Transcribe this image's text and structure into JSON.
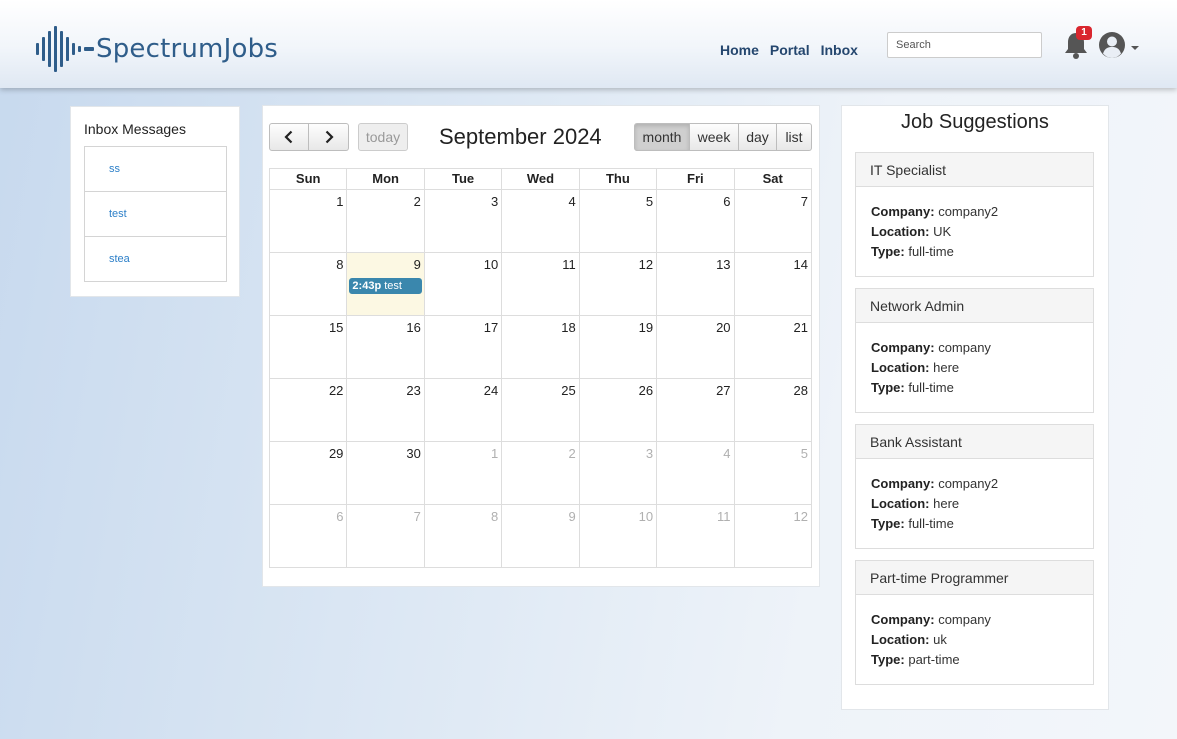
{
  "brand": {
    "logo_text": "SpectrumJobs",
    "color": "#2f5d8a"
  },
  "nav": {
    "home": "Home",
    "portal": "Portal",
    "inbox": "Inbox"
  },
  "search": {
    "placeholder": "Search"
  },
  "notifications": {
    "count": "1",
    "icon": "bell-icon"
  },
  "user": {
    "icon": "user-circle-icon"
  },
  "inbox": {
    "title": "Inbox Messages",
    "messages": [
      "ss",
      "test",
      "stea"
    ]
  },
  "calendar": {
    "title": "September 2024",
    "today_label": "today",
    "prev_icon": "chevron-left-icon",
    "next_icon": "chevron-right-icon",
    "views": [
      "month",
      "week",
      "day",
      "list"
    ],
    "active_view": "month",
    "weekdays": [
      "Sun",
      "Mon",
      "Tue",
      "Wed",
      "Thu",
      "Fri",
      "Sat"
    ],
    "weeks": [
      [
        "1",
        "2",
        "3",
        "4",
        "5",
        "6",
        "7"
      ],
      [
        "8",
        "9",
        "10",
        "11",
        "12",
        "13",
        "14"
      ],
      [
        "15",
        "16",
        "17",
        "18",
        "19",
        "20",
        "21"
      ],
      [
        "22",
        "23",
        "24",
        "25",
        "26",
        "27",
        "28"
      ],
      [
        "29",
        "30",
        "1",
        "2",
        "3",
        "4",
        "5"
      ],
      [
        "6",
        "7",
        "8",
        "9",
        "10",
        "11",
        "12"
      ]
    ],
    "today_date": "9",
    "event": {
      "time": "2:43p",
      "title": "test",
      "day": "9",
      "color": "#3a87ad"
    }
  },
  "jobs": {
    "title": "Job Suggestions",
    "labels": {
      "company": "Company:",
      "location": "Location:",
      "type": "Type:"
    },
    "items": [
      {
        "title": "IT Specialist",
        "company": "company2",
        "location": "UK",
        "type": "full-time"
      },
      {
        "title": "Network Admin",
        "company": "company",
        "location": "here",
        "type": "full-time"
      },
      {
        "title": "Bank Assistant",
        "company": "company2",
        "location": "here",
        "type": "full-time"
      },
      {
        "title": "Part-time Programmer",
        "company": "company",
        "location": "uk",
        "type": "part-time"
      }
    ]
  }
}
